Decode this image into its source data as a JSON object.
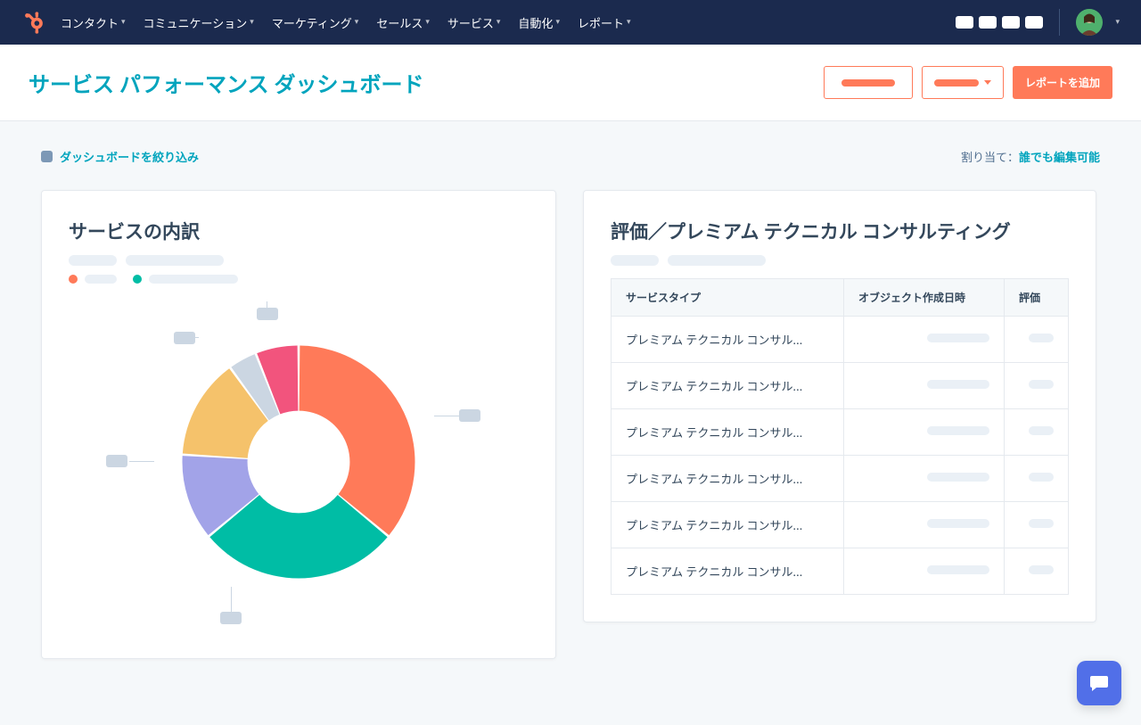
{
  "nav": {
    "items": [
      "コンタクト",
      "コミュニケーション",
      "マーケティング",
      "セールス",
      "サービス",
      "自動化",
      "レポート"
    ]
  },
  "header": {
    "title": "サービス パフォーマンス ダッシュボード",
    "add_report_btn": "レポートを追加"
  },
  "subheader": {
    "filter_label": "ダッシュボードを絞り込み",
    "assignment_label": "割り当て：",
    "assignment_value": "誰でも編集可能"
  },
  "cards": {
    "left": {
      "title": "サービスの内訳"
    },
    "right": {
      "title": "評価／プレミアム テクニカル コンサルティング",
      "table": {
        "headers": [
          "サービスタイプ",
          "オブジェクト作成日時",
          "評価"
        ],
        "rows": [
          {
            "service": "プレミアム テクニカル コンサル..."
          },
          {
            "service": "プレミアム テクニカル コンサル..."
          },
          {
            "service": "プレミアム テクニカル コンサル..."
          },
          {
            "service": "プレミアム テクニカル コンサル..."
          },
          {
            "service": "プレミアム テクニカル コンサル..."
          },
          {
            "service": "プレミアム テクニカル コンサル..."
          }
        ]
      }
    }
  },
  "chart_data": {
    "type": "pie",
    "title": "サービスの内訳",
    "series": [
      {
        "name": "segment-orange",
        "color": "#ff7a59",
        "value": 36
      },
      {
        "name": "segment-teal",
        "color": "#00bda5",
        "value": 28
      },
      {
        "name": "segment-lavender",
        "color": "#a2a3e8",
        "value": 12
      },
      {
        "name": "segment-yellow",
        "color": "#f5c26b",
        "value": 14
      },
      {
        "name": "segment-gray",
        "color": "#cbd6e2",
        "value": 4
      },
      {
        "name": "segment-pink",
        "color": "#f2547d",
        "value": 6
      }
    ],
    "inner_radius_pct": 44
  },
  "colors": {
    "accent": "#ff7a59",
    "brand_teal": "#00a4bd"
  }
}
